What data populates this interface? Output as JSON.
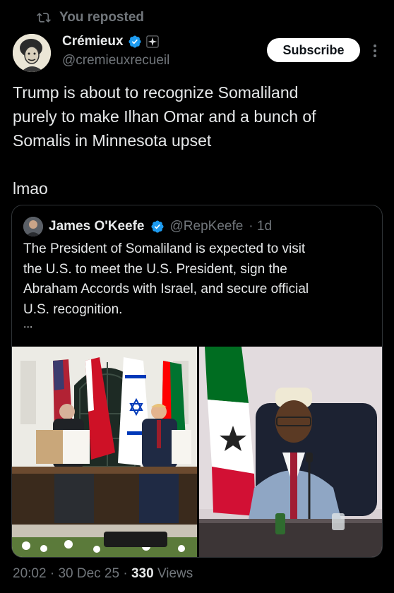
{
  "repost": {
    "label": "You reposted",
    "icon": "repost-icon"
  },
  "author": {
    "name": "Crémieux",
    "handle": "@cremieuxrecueil",
    "verified": true,
    "subscribe_label": "Subscribe"
  },
  "tweet": {
    "line1": "Trump is about to recognize Somaliland",
    "line2": "purely to make Ilhan Omar and a bunch of",
    "line3": "Somalis in Minnesota upset",
    "line4": "lmao"
  },
  "quote": {
    "name": "James O'Keefe",
    "handle": "@RepKeefe",
    "time": "· 1d",
    "line1": "The President of Somaliland is expected to visit",
    "line2": "the U.S. to meet the U.S. President, sign the",
    "line3": "Abraham Accords with Israel, and secure official",
    "line4": "U.S. recognition.",
    "ellipsis": "..."
  },
  "meta": {
    "time": "20:02",
    "date": "30 Dec 25",
    "views_count": "330",
    "views_label": "Views",
    "sep": "·"
  },
  "colors": {
    "background": "#000000",
    "text": "#e7e9ea",
    "muted": "#71767b",
    "verified": "#1d9bf0",
    "border": "#2f3336"
  }
}
